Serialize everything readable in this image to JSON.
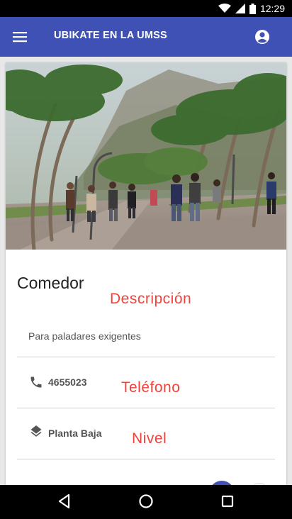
{
  "status_bar": {
    "time": "12:29"
  },
  "app_bar": {
    "title": "UBIKATE EN LA UMSS"
  },
  "place": {
    "name": "Comedor",
    "description": "Para paladares exigentes",
    "phone": "4655023",
    "level": "Planta Baja"
  },
  "annotations": {
    "description": "Descripción",
    "phone": "Teléfono",
    "level": "Nivel"
  },
  "icons": {
    "menu": "hamburger-menu-icon",
    "account": "account-circle-icon",
    "phone": "phone-icon",
    "level": "layers-icon",
    "nav_back": "back-triangle-icon",
    "nav_home": "home-circle-icon",
    "nav_recents": "recents-square-icon"
  },
  "colors": {
    "primary": "#3f51b5",
    "annotation": "#f0433a"
  }
}
